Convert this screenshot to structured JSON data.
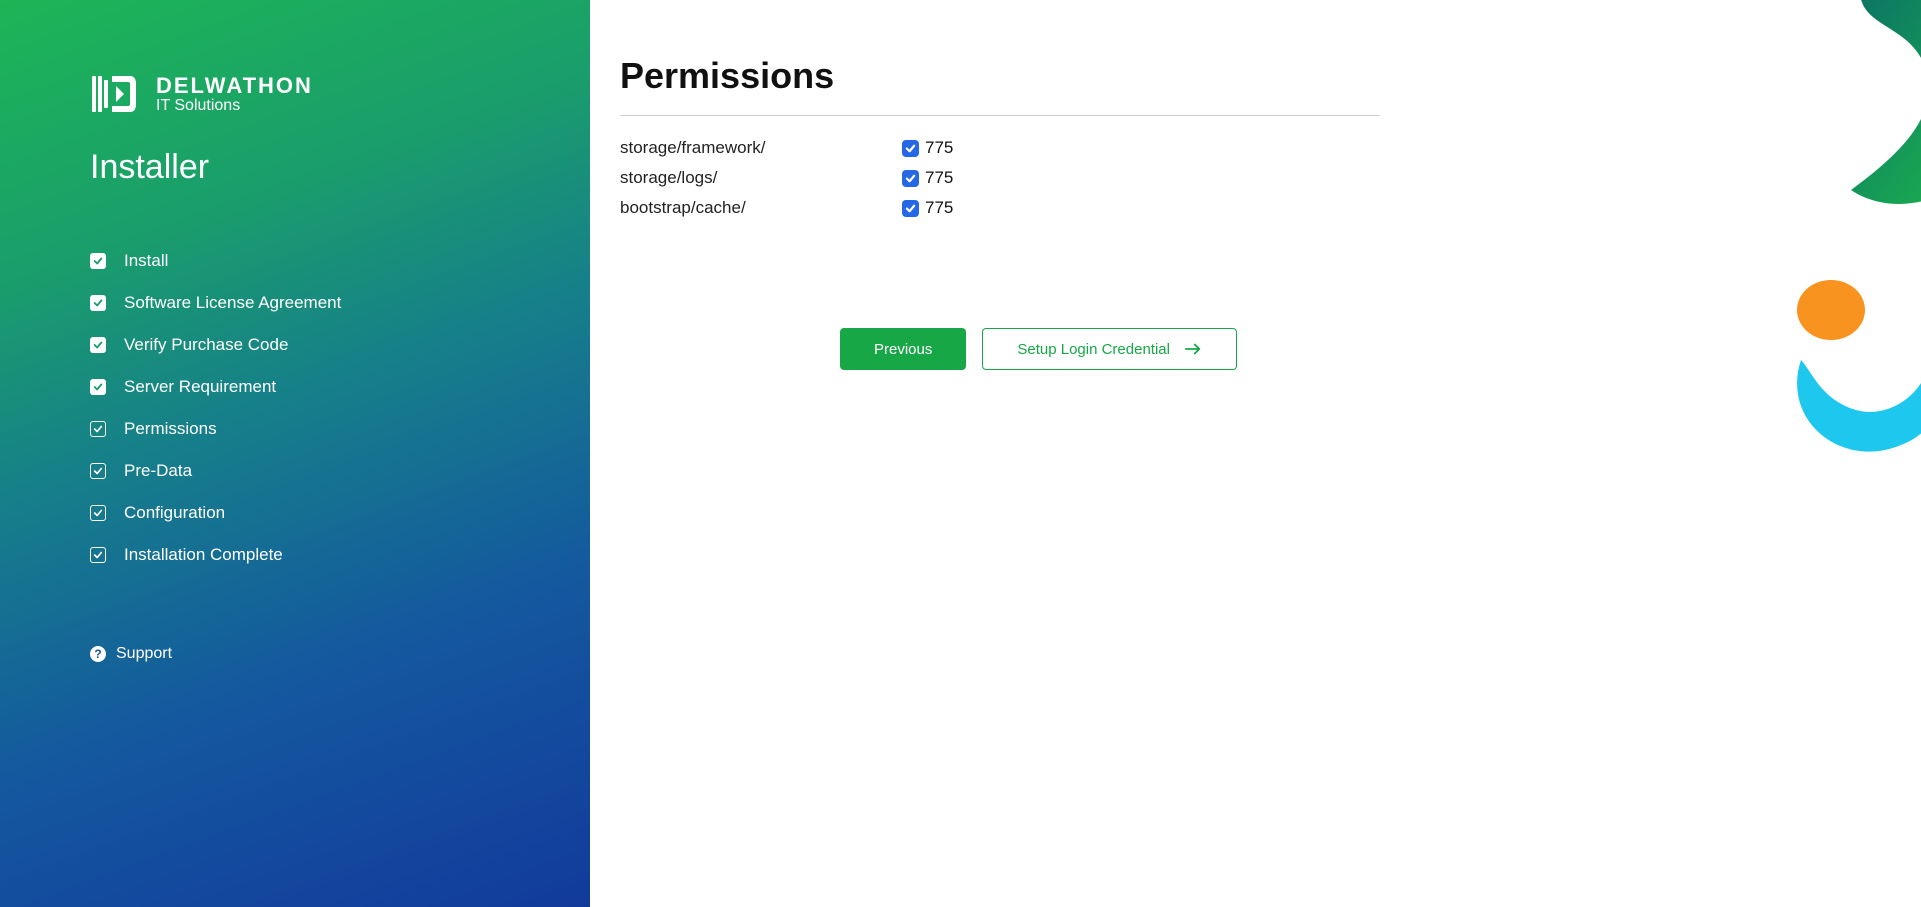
{
  "brand": {
    "name": "DELWATHON",
    "tagline": "IT Solutions",
    "installer_label": "Installer"
  },
  "sidebar": {
    "steps": [
      {
        "label": "Install",
        "state": "done"
      },
      {
        "label": "Software License Agreement",
        "state": "done"
      },
      {
        "label": "Verify Purchase Code",
        "state": "done"
      },
      {
        "label": "Server Requirement",
        "state": "done"
      },
      {
        "label": "Permissions",
        "state": "current"
      },
      {
        "label": "Pre-Data",
        "state": "pending"
      },
      {
        "label": "Configuration",
        "state": "pending"
      },
      {
        "label": "Installation Complete",
        "state": "pending"
      }
    ],
    "support_label": "Support"
  },
  "page": {
    "title": "Permissions",
    "permissions": [
      {
        "path": "storage/framework/",
        "mode": "775",
        "ok": true
      },
      {
        "path": "storage/logs/",
        "mode": "775",
        "ok": true
      },
      {
        "path": "bootstrap/cache/",
        "mode": "775",
        "ok": true
      }
    ],
    "prev_button": "Previous",
    "next_button": "Setup Login Credential"
  },
  "colors": {
    "accent_green": "#17a746",
    "checkbox_blue": "#2468e6"
  }
}
